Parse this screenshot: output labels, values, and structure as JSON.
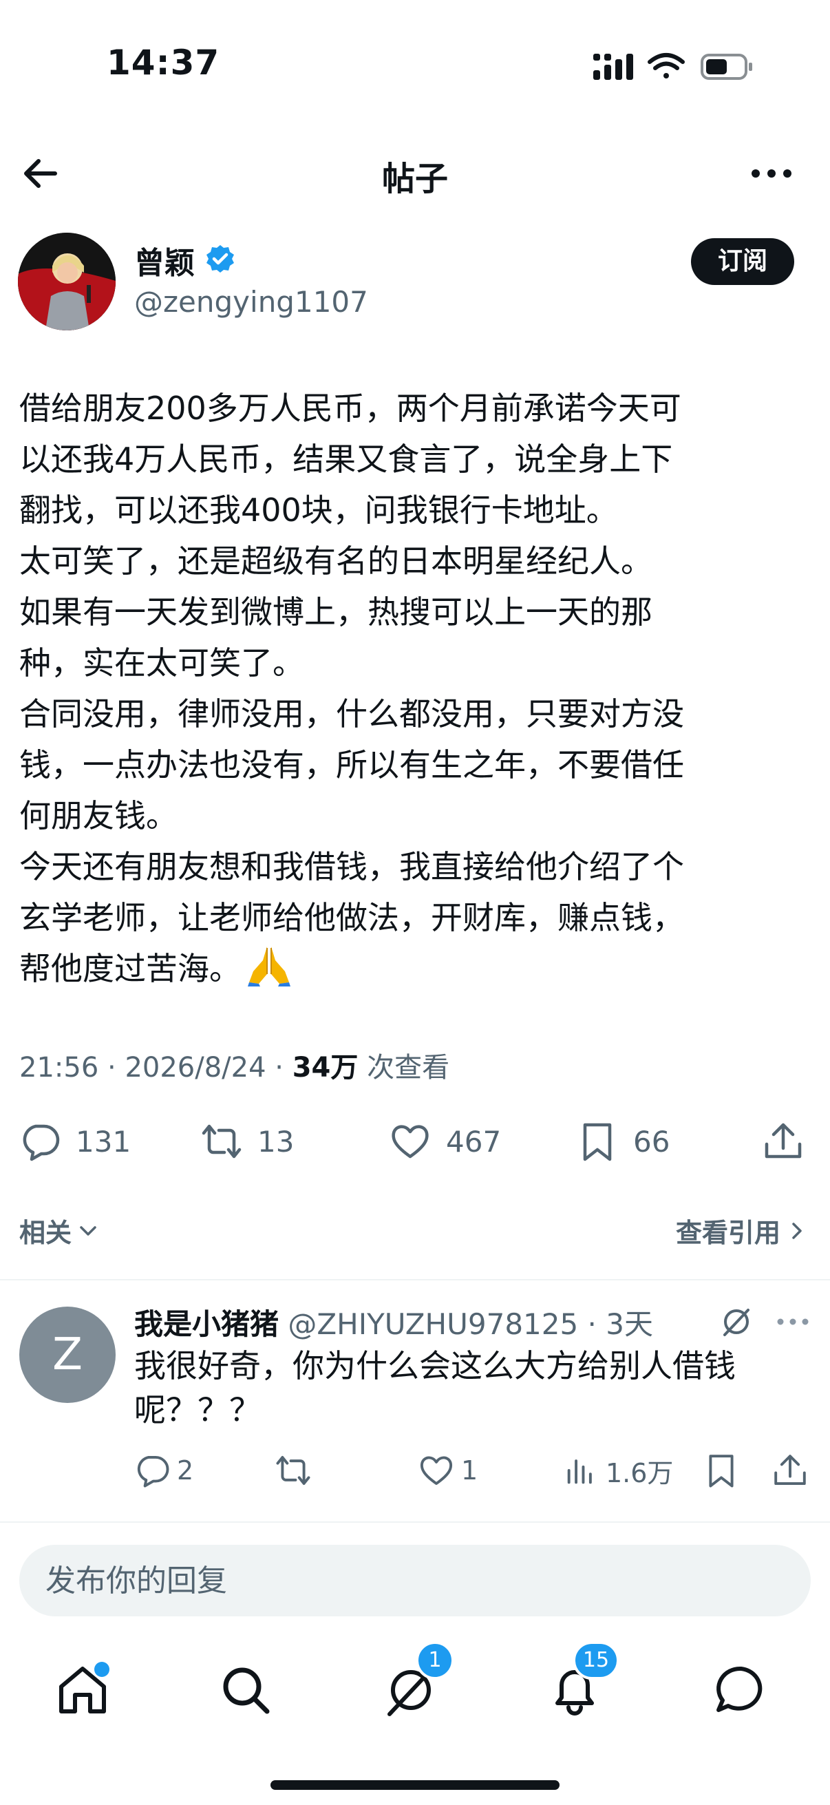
{
  "status_bar": {
    "time": "14:37"
  },
  "header": {
    "title": "帖子"
  },
  "author": {
    "name": "曾颖",
    "handle": "@zengying1107",
    "subscribe_label": "订阅"
  },
  "post": {
    "body": "借给朋友200多万人民币，两个月前承诺今天可\n以还我4万人民币，结果又食言了，说全身上下\n翻找，可以还我400块，问我银行卡地址。\n太可笑了，还是超级有名的日本明星经纪人。\n如果有一天发到微博上，热搜可以上一天的那\n种，实在太可笑了。\n合同没用，律师没用，什么都没用，只要对方没\n钱，一点办法也没有，所以有生之年，不要借任\n何朋友钱。\n今天还有朋友想和我借钱，我直接给他介绍了个\n玄学老师，让老师给他做法，开财库，赚点钱，\n帮他度过苦海。",
    "emoji": "🙏",
    "time": "21:56",
    "date": "2026/8/24",
    "views": "34万",
    "views_label": "次查看"
  },
  "actions": {
    "replies": "131",
    "reposts": "13",
    "likes": "467",
    "bookmarks": "66"
  },
  "related": {
    "label": "相关",
    "quotes_label": "查看引用"
  },
  "reply": {
    "avatar_letter": "Z",
    "name": "我是小猪猪",
    "handle": "@ZHIYUZHU978125",
    "time": "3天",
    "text": "我很好奇，你为什么会这么大方给别人借钱\n呢？？？",
    "replies": "2",
    "likes": "1",
    "views": "1.6万"
  },
  "compose": {
    "placeholder": "发布你的回复"
  },
  "nav": {
    "messages_badge": "1",
    "notifications_badge": "15"
  },
  "colors": {
    "accent": "#1d9bf0",
    "text": "#0f1419",
    "secondary": "#536471"
  }
}
